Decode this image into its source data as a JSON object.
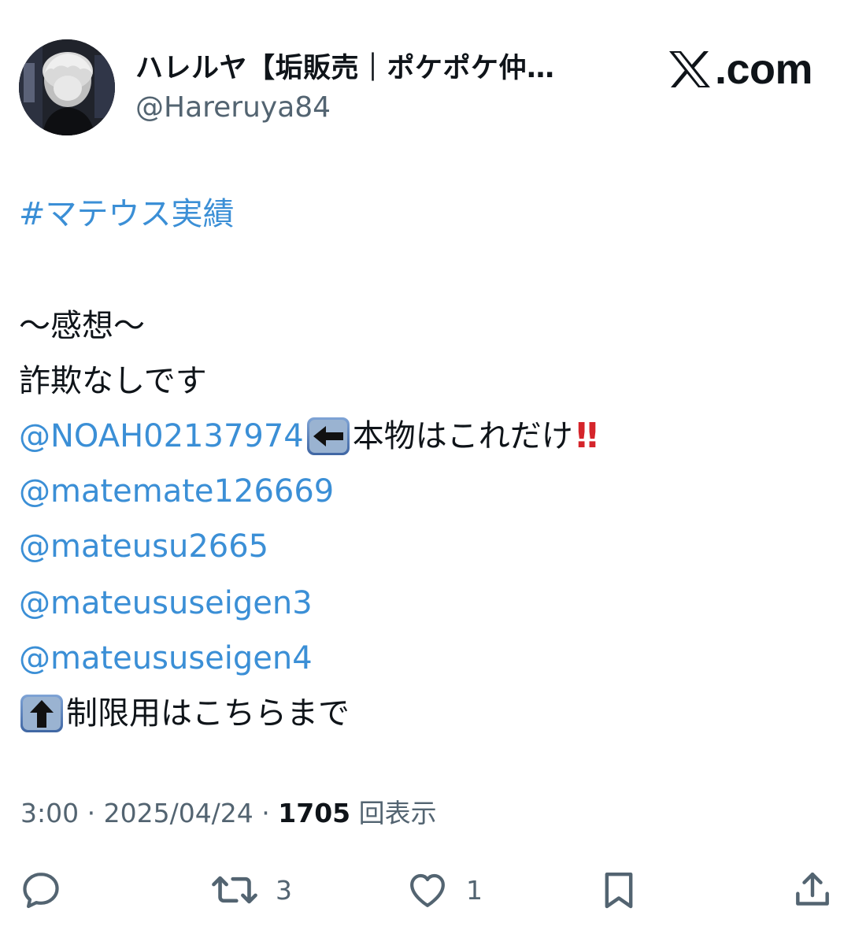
{
  "author": {
    "display_name": "ハレルヤ【垢販売｜ポケポケ仲…",
    "handle": "@Hareruya84"
  },
  "brand": {
    "text": ".com"
  },
  "tweet": {
    "hashtag": "#マテウス実績",
    "heading": "〜感想〜",
    "line1": "詐欺なしです",
    "mention1": "@NOAH02137974",
    "after_mention1": "本物はこれだけ",
    "bangs": "‼",
    "mention2": "@matemate126669",
    "mention3": "@mateusu2665",
    "mention4": "@mateususeigen3",
    "mention5": "@mateususeigen4",
    "last_line": "制限用はこちらまで",
    "emojis": [
      "left-arrow-icon",
      "up-arrow-icon"
    ]
  },
  "meta": {
    "time": "3:00",
    "sep1": " · ",
    "date": "2025/04/24",
    "sep2": " · ",
    "views": "1705",
    "views_label": " 回表示"
  },
  "actions": {
    "reply": {
      "icon": "reply-icon",
      "count": ""
    },
    "retweet": {
      "icon": "retweet-icon",
      "count": "3"
    },
    "like": {
      "icon": "heart-icon",
      "count": "1"
    },
    "bookmark": {
      "icon": "bookmark-icon",
      "count": ""
    },
    "share": {
      "icon": "share-icon",
      "count": ""
    }
  },
  "colors": {
    "link": "#3b8fd6",
    "secondary_text": "#536471",
    "primary_text": "#0f1419",
    "emoji_frame": "#4a6fa5",
    "bangs": "#d5252b"
  }
}
